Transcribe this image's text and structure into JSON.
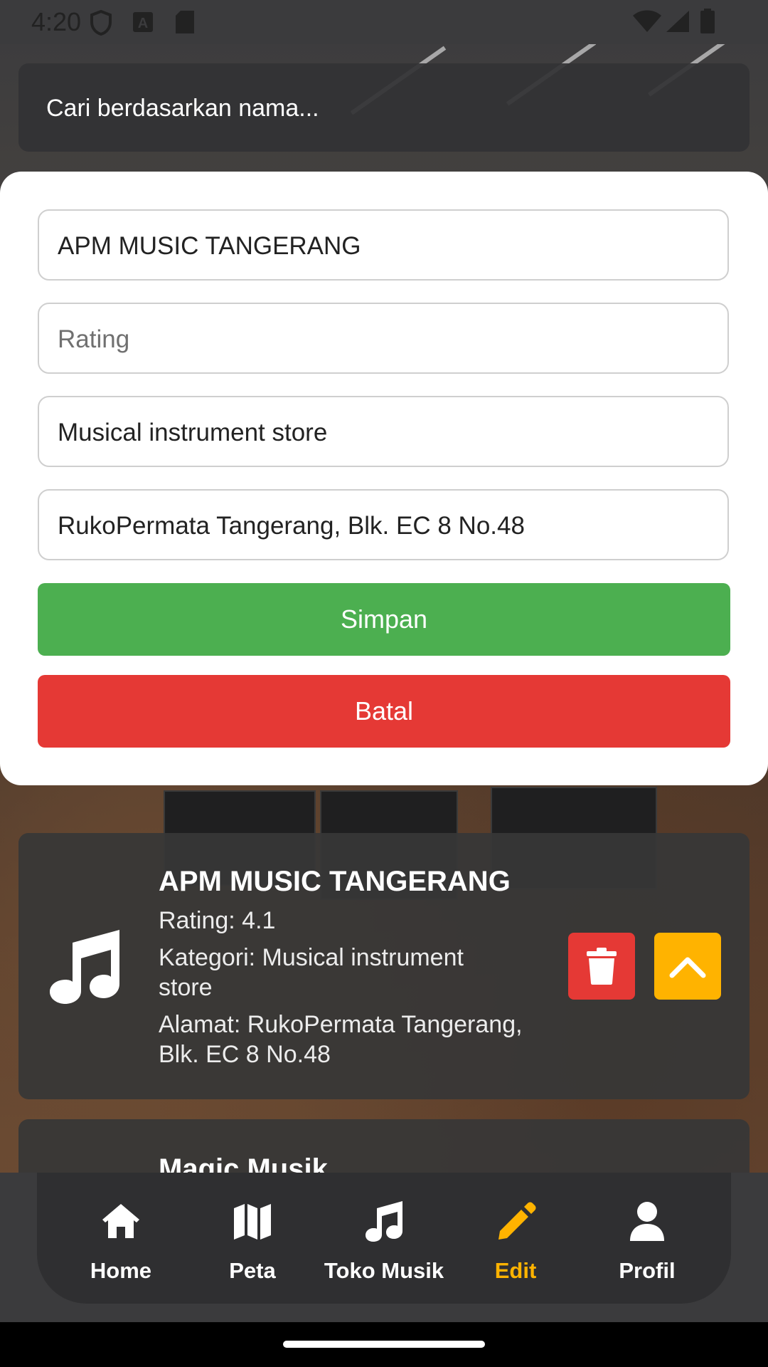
{
  "status_bar": {
    "time": "4:20"
  },
  "search": {
    "placeholder": "Cari berdasarkan nama..."
  },
  "edit_form": {
    "name_value": "APM MUSIC TANGERANG",
    "rating_placeholder": "Rating",
    "category_value": "Musical instrument store",
    "address_value": "RukoPermata Tangerang, Blk. EC 8 No.48",
    "save_label": "Simpan",
    "cancel_label": "Batal"
  },
  "stores": [
    {
      "name": "APM MUSIC TANGERANG",
      "rating": "Rating: 4.1",
      "category_line1": "Kategori: Musical instrument",
      "category_line2": "store",
      "address_line1": "Alamat: RukoPermata Tangerang,",
      "address_line2": "Blk. EC 8 No.48"
    },
    {
      "name": "Magic Musik"
    }
  ],
  "bottom_nav": {
    "items": [
      {
        "label": "Home",
        "icon": "home-icon"
      },
      {
        "label": "Peta",
        "icon": "map-icon"
      },
      {
        "label": "Toko Musik",
        "icon": "music-note-icon"
      },
      {
        "label": "Edit",
        "icon": "pencil-icon",
        "active": true
      },
      {
        "label": "Profil",
        "icon": "person-icon"
      }
    ],
    "active_color": "#ffb300"
  },
  "colors": {
    "save": "#4caf50",
    "cancel": "#e53935",
    "delete": "#e53935",
    "accent": "#ffb300"
  }
}
